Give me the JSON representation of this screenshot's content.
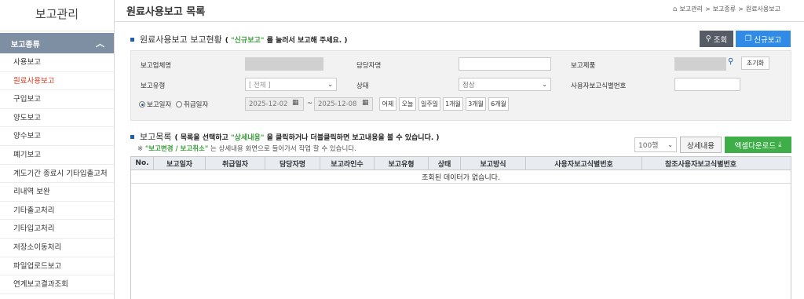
{
  "sidebar": {
    "brand": "보고관리",
    "group": "보고종류",
    "items": [
      {
        "label": "사용보고",
        "active": false
      },
      {
        "label": "원료사용보고",
        "active": true
      },
      {
        "label": "구입보고",
        "active": false
      },
      {
        "label": "양도보고",
        "active": false
      },
      {
        "label": "양수보고",
        "active": false
      },
      {
        "label": "폐기보고",
        "active": false
      },
      {
        "label": "계도기간 종료시 기타입출고처",
        "active": false
      },
      {
        "label": "리내역 보완",
        "active": false
      },
      {
        "label": "기타출고처리",
        "active": false
      },
      {
        "label": "기타입고처리",
        "active": false
      },
      {
        "label": "저장소이동처리",
        "active": false
      },
      {
        "label": "파일업로드보고",
        "active": false
      },
      {
        "label": "연계보고결과조회",
        "active": false
      }
    ]
  },
  "header": {
    "title": "원료사용보고 목록",
    "breadcrumb": [
      "보고관리",
      "보고종류",
      "원료사용보고"
    ]
  },
  "status_section": {
    "title": "원료사용보고 보고현황",
    "note_prefix": "( ",
    "note_highlight": "\"신규보고\"",
    "note_suffix": " 를 눌러서 보고해 주세요. )",
    "search_label": "조회",
    "new_report_label": "신규보고"
  },
  "filter": {
    "company_label": "보고업체명",
    "manager_label": "담당자명",
    "product_label": "보고제품",
    "reset_label": "초기화",
    "type_label": "보고유형",
    "type_value": "[ 전체 ]",
    "status_label": "상태",
    "status_value": "정상",
    "user_id_label": "사용자보고식별번호",
    "radio_report_date": "보고일자",
    "radio_cancel_date": "취급일자",
    "date_from": "2025-12-02",
    "date_sep": "~",
    "date_to": "2025-12-08",
    "quick": [
      "어제",
      "오늘",
      "일주일",
      "1개월",
      "3개월",
      "6개월"
    ]
  },
  "list_section": {
    "title": "보고목록",
    "note_prefix": "( 목록을 선택하고 ",
    "note_highlight": "\"상세내용\"",
    "note_suffix": " 을 클릭하거나 더블클릭하면 보고내용을 볼 수 있습니다. )",
    "sub_prefix": "※ ",
    "sub_highlight": "\"보고변경 / 보고취소\"",
    "sub_suffix": " 는 상세내용 화면으로 들어가서 작업 할 수 있습니다.",
    "rows_value": "100행",
    "detail_label": "상세내용",
    "excel_label": "엑셀다운로드"
  },
  "table": {
    "columns": [
      "No.",
      "보고일자",
      "취급일자",
      "담당자명",
      "보고라인수",
      "보고유형",
      "상태",
      "보고방식",
      "사용자보고식별번호",
      "참조사용자보고식별번호"
    ],
    "empty_message": "조회된 데이터가 없습니다."
  }
}
